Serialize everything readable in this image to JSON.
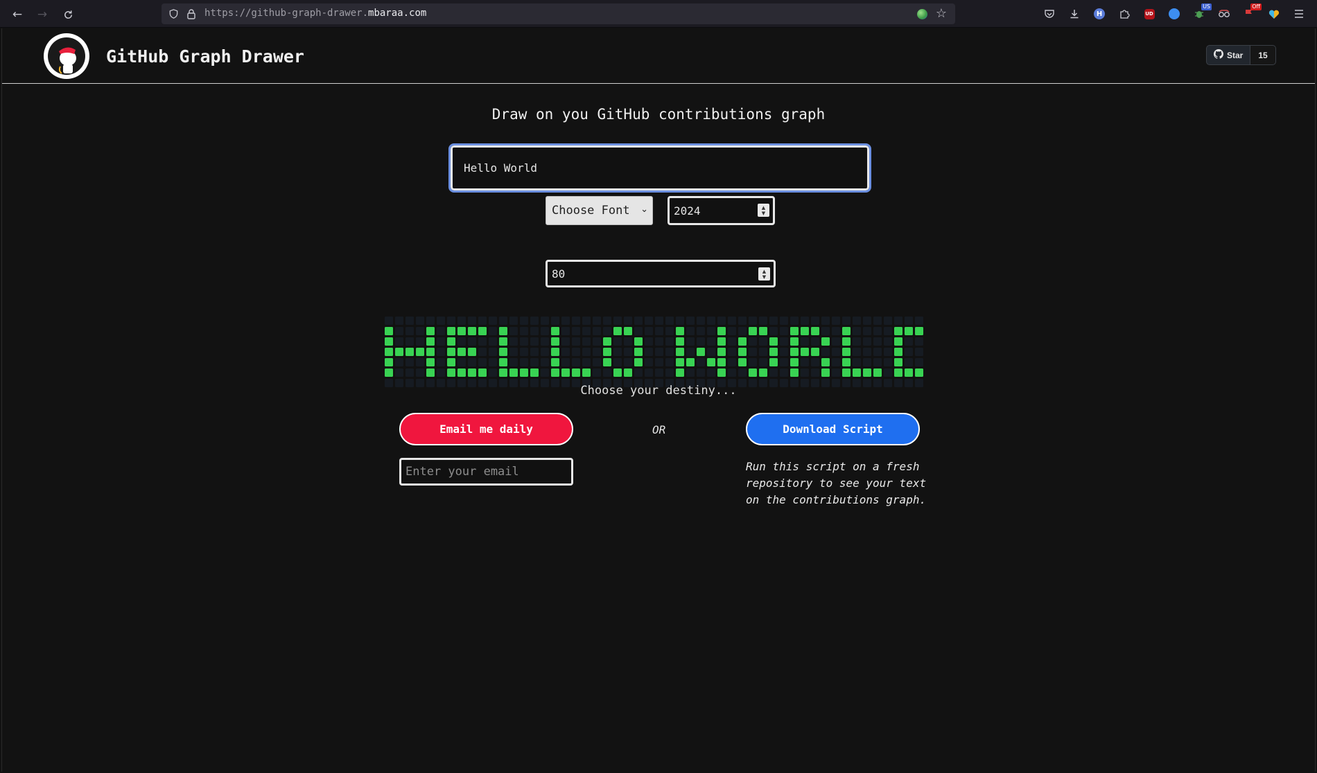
{
  "browser": {
    "url_prefix": "https://github-graph-drawer.",
    "url_domain": "mbaraa.com",
    "extension_badges": {
      "us": "US",
      "off": "Off",
      "ud": "UD"
    }
  },
  "header": {
    "title": "GitHub Graph Drawer",
    "star_label": "Star",
    "star_count": "15"
  },
  "main": {
    "headline": "Draw on you GitHub contributions graph",
    "text_value": "Hello World",
    "font_select": "Choose Font",
    "year_value": "2024",
    "count_value": "80",
    "destiny": "Choose your destiny...",
    "email_button": "Email me daily",
    "or_label": "OR",
    "download_button": "Download Script",
    "email_placeholder": "Enter your email",
    "script_note": "Run this script on a fresh repository to see your text on the contributions graph."
  },
  "graph": {
    "weeks": 52,
    "days": 7,
    "colors": {
      "empty": "#161b22",
      "filled": "#39d353"
    },
    "pattern": [
      "H...H.HHHH.H....H.....HH....H...H..HH..HHH..H....HHH.",
      "H...H.H....H....H....H..H...H...H.H..H.H..H.H....H..H",
      "HHHHH.HHH..H....H....H..H...H.H.H.H..H.HHH..H....H..H",
      "H...H.H....H....H....H..H...HH.HH.H..H.H..H.H....H..H",
      "H...H.HHHH.HHHH.HHHH..HH....H...H..HH..H..H.HHHH.HHH."
    ]
  }
}
